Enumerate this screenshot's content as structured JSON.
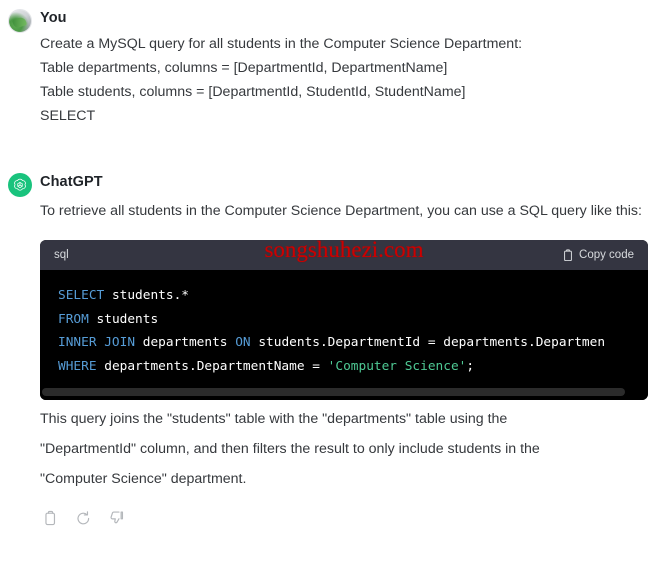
{
  "messages": {
    "user": {
      "author": "You",
      "avatar_icon": "user-avatar-photo",
      "lines": [
        "Create a MySQL query for all students in the Computer Science Department:",
        "Table departments, columns = [DepartmentId, DepartmentName]",
        "Table students, columns = [DepartmentId, StudentId, StudentName]",
        "SELECT"
      ]
    },
    "assistant": {
      "author": "ChatGPT",
      "avatar_icon": "openai-logo-icon",
      "intro": "To retrieve all students in the Computer Science Department, you can use a SQL query like this:",
      "code_block": {
        "language_label": "sql",
        "copy_label": "Copy code",
        "copy_icon": "clipboard-icon",
        "watermark": "songshuhezi.com",
        "watermark_color": "#cc0000",
        "background_color": "#000000",
        "header_color": "#343541",
        "keyword_color": "#569cd6",
        "string_color": "#4ec994",
        "plain_color": "#ffffff",
        "lines": [
          [
            {
              "t": "SELECT",
              "c": "kw"
            },
            {
              "t": " students.*",
              "c": "pl"
            }
          ],
          [
            {
              "t": "FROM",
              "c": "kw"
            },
            {
              "t": " students",
              "c": "pl"
            }
          ],
          [
            {
              "t": "INNER JOIN",
              "c": "kw"
            },
            {
              "t": " departments ",
              "c": "pl"
            },
            {
              "t": "ON",
              "c": "kw"
            },
            {
              "t": " students.DepartmentId = departments.Departmen",
              "c": "pl"
            }
          ],
          [
            {
              "t": "WHERE",
              "c": "kw"
            },
            {
              "t": " departments.DepartmentName = ",
              "c": "pl"
            },
            {
              "t": "'Computer Science'",
              "c": "str"
            },
            {
              "t": ";",
              "c": "pl"
            }
          ]
        ]
      },
      "explanation": [
        "This query joins the \"students\" table with the \"departments\" table using the",
        "\"DepartmentId\" column, and then filters the result to only include students in the",
        "\"Computer Science\" department."
      ],
      "actions": [
        {
          "name": "copy-message-icon",
          "icon": "clipboard"
        },
        {
          "name": "regenerate-icon",
          "icon": "refresh"
        },
        {
          "name": "thumbs-down-icon",
          "icon": "thumbs-down"
        }
      ]
    }
  }
}
